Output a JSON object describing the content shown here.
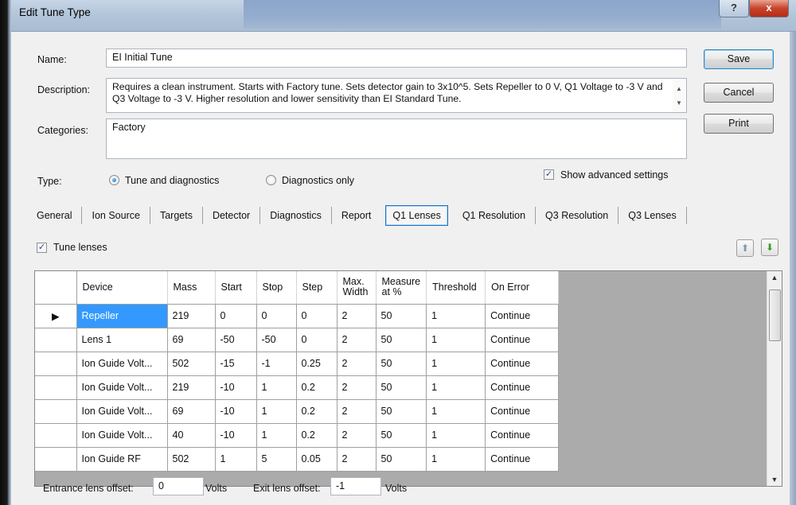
{
  "window": {
    "title": "Edit Tune Type",
    "help_glyph": "?",
    "close_glyph": "x"
  },
  "form": {
    "name_label": "Name:",
    "name_value": "EI Initial Tune",
    "description_label": "Description:",
    "description_value": "Requires a clean instrument. Starts with Factory tune. Sets detector gain to 3x10^5. Sets Repeller to 0 V, Q1 Voltage to -3 V and Q3 Voltage to -3 V. Higher resolution and lower sensitivity than EI Standard Tune.",
    "categories_label": "Categories:",
    "categories_value": "Factory",
    "type_label": "Type:",
    "type_option_1": "Tune and diagnostics",
    "type_option_2": "Diagnostics only",
    "show_advanced": "Show advanced settings",
    "tune_lenses": "Tune lenses"
  },
  "buttons": {
    "save": "Save",
    "cancel": "Cancel",
    "print": "Print"
  },
  "tabs": [
    "General",
    "Ion Source",
    "Targets",
    "Detector",
    "Diagnostics",
    "Report",
    "Q1 Lenses",
    "Q1 Resolution",
    "Q3 Resolution",
    "Q3 Lenses"
  ],
  "grid": {
    "headers": [
      "Device",
      "Mass",
      "Start",
      "Stop",
      "Step",
      "Max.\nWidth",
      "Measure\nat %",
      "Threshold",
      "On Error"
    ],
    "rows": [
      [
        "Repeller",
        "219",
        "0",
        "0",
        "0",
        "2",
        "50",
        "1",
        "Continue"
      ],
      [
        "Lens 1",
        "69",
        "-50",
        "-50",
        "0",
        "2",
        "50",
        "1",
        "Continue"
      ],
      [
        "Ion Guide Volt...",
        "502",
        "-15",
        "-1",
        "0.25",
        "2",
        "50",
        "1",
        "Continue"
      ],
      [
        "Ion Guide Volt...",
        "219",
        "-10",
        "1",
        "0.2",
        "2",
        "50",
        "1",
        "Continue"
      ],
      [
        "Ion Guide Volt...",
        "69",
        "-10",
        "1",
        "0.2",
        "2",
        "50",
        "1",
        "Continue"
      ],
      [
        "Ion Guide Volt...",
        "40",
        "-10",
        "1",
        "0.2",
        "2",
        "50",
        "1",
        "Continue"
      ],
      [
        "Ion Guide RF",
        "502",
        "1",
        "5",
        "0.05",
        "2",
        "50",
        "1",
        "Continue"
      ]
    ]
  },
  "offsets": {
    "entrance_label": "Entrance lens offset:",
    "entrance_value": "0",
    "entrance_unit": "Volts",
    "exit_label": "Exit lens offset:",
    "exit_value": "-1",
    "exit_unit": "Volts"
  }
}
